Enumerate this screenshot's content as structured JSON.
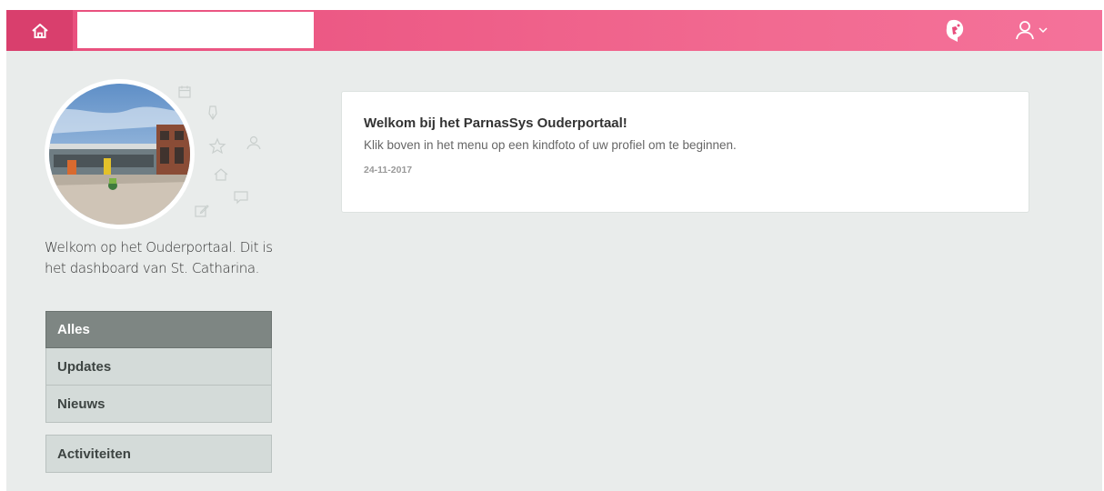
{
  "header": {
    "home_icon": "home-icon",
    "logo_icon": "parnassys-logo-icon",
    "user_icon": "user-icon",
    "chevron_icon": "chevron-down-icon",
    "brand_color": "#e84d7c"
  },
  "sidebar": {
    "welcome_text": "Welkom op het Ouderportaal. Dit is het dashboard van St. Catharina.",
    "menu": [
      {
        "label": "Alles",
        "active": true
      },
      {
        "label": "Updates",
        "active": false
      },
      {
        "label": "Nieuws",
        "active": false
      }
    ],
    "menu_extra": {
      "label": "Activiteiten"
    },
    "decor_icons": [
      "calendar-icon",
      "pen-icon",
      "star-icon",
      "user-icon",
      "home-icon",
      "chat-icon",
      "edit-icon"
    ]
  },
  "main": {
    "card": {
      "title": "Welkom bij het ParnasSys Ouderportaal!",
      "body": "Klik boven in het menu op een kindfoto of uw profiel om te beginnen.",
      "date": "24-11-2017"
    }
  }
}
